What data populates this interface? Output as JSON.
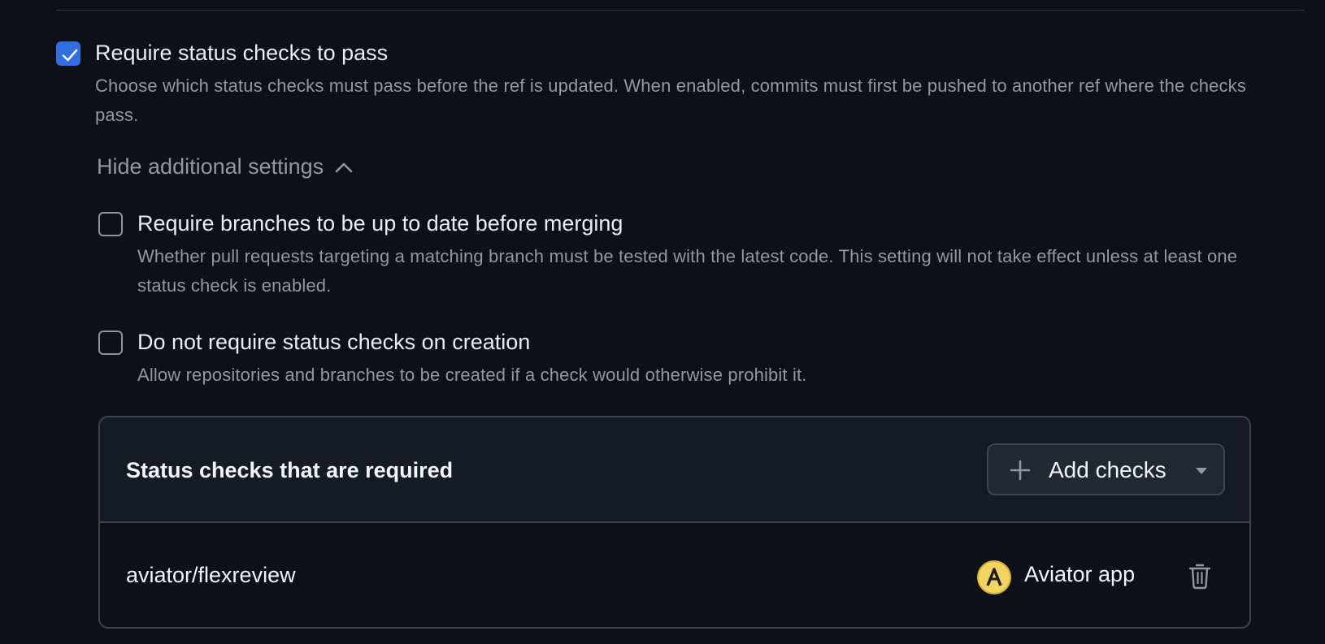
{
  "status_checks_rule": {
    "checked": true,
    "label": "Require status checks to pass",
    "description": "Choose which status checks must pass before the ref is updated. When enabled, commits must first be pushed to another ref where the checks pass."
  },
  "additional_settings_toggle": {
    "label": "Hide additional settings",
    "icon": "chevron-up-icon"
  },
  "options": [
    {
      "checked": false,
      "label": "Require branches to be up to date before merging",
      "description": "Whether pull requests targeting a matching branch must be tested with the latest code. This setting will not take effect unless at least one status check is enabled."
    },
    {
      "checked": false,
      "label": "Do not require status checks on creation",
      "description": "Allow repositories and branches to be created if a check would otherwise prohibit it."
    }
  ],
  "required_checks": {
    "title": "Status checks that are required",
    "add_button_label": "Add checks",
    "items": [
      {
        "name": "aviator/flexreview",
        "app": "Aviator app",
        "app_icon": "aviator-logo-icon"
      }
    ]
  },
  "colors": {
    "background": "#0d1117",
    "accent": "#2f6fe0",
    "panel_header": "#151b23",
    "border": "#3d444d",
    "muted_text": "#9198a1",
    "aviator_yellow": "#f4d35e"
  }
}
